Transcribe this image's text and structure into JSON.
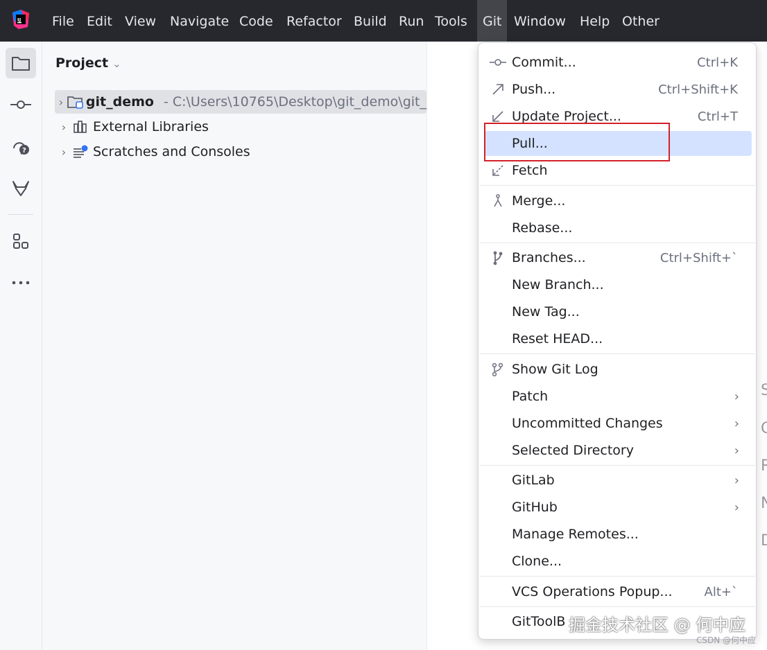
{
  "menubar": {
    "items": [
      "File",
      "Edit",
      "View",
      "Navigate",
      "Code",
      "Refactor",
      "Build",
      "Run",
      "Tools",
      "Git",
      "Window",
      "Help",
      "Other"
    ],
    "active": "Git"
  },
  "toolstrip": {
    "icons": [
      "project-folder-icon",
      "commit-icon",
      "help-icon",
      "gitlab-icon",
      "structure-icon",
      "more-icon"
    ]
  },
  "project": {
    "title": "Project",
    "tree": [
      {
        "label": "git_demo",
        "path": "- C:\\Users\\10765\\Desktop\\git_demo\\git_"
      },
      {
        "label": "External Libraries"
      },
      {
        "label": "Scratches and Consoles"
      }
    ]
  },
  "git_menu": {
    "items": [
      {
        "label": "Commit...",
        "shortcut": "Ctrl+K"
      },
      {
        "label": "Push...",
        "shortcut": "Ctrl+Shift+K"
      },
      {
        "label": "Update Project...",
        "shortcut": "Ctrl+T"
      },
      {
        "label": "Pull...",
        "shortcut": ""
      },
      {
        "label": "Fetch",
        "shortcut": ""
      },
      {
        "label": "Merge...",
        "shortcut": ""
      },
      {
        "label": "Rebase...",
        "shortcut": ""
      },
      {
        "label": "Branches...",
        "shortcut": "Ctrl+Shift+`"
      },
      {
        "label": "New Branch...",
        "shortcut": ""
      },
      {
        "label": "New Tag...",
        "shortcut": ""
      },
      {
        "label": "Reset HEAD...",
        "shortcut": ""
      },
      {
        "label": "Show Git Log",
        "shortcut": ""
      },
      {
        "label": "Patch",
        "shortcut": ""
      },
      {
        "label": "Uncommitted Changes",
        "shortcut": ""
      },
      {
        "label": "Selected Directory",
        "shortcut": ""
      },
      {
        "label": "GitLab",
        "shortcut": ""
      },
      {
        "label": "GitHub",
        "shortcut": ""
      },
      {
        "label": "Manage Remotes...",
        "shortcut": ""
      },
      {
        "label": "Clone...",
        "shortcut": ""
      },
      {
        "label": "VCS Operations Popup...",
        "shortcut": "Alt+`"
      },
      {
        "label": "GitToolB",
        "shortcut": ""
      }
    ],
    "highlighted": "Pull..."
  },
  "editor_edge_letters": [
    "S",
    "G",
    "R",
    "N",
    "D"
  ],
  "watermark": {
    "main": "掘金技术社区 @ 何中应",
    "small": "CSDN @何中应"
  },
  "colors": {
    "titlebar": "#27282e",
    "highlight": "#d4e2ff",
    "annotation": "#d4202a"
  }
}
